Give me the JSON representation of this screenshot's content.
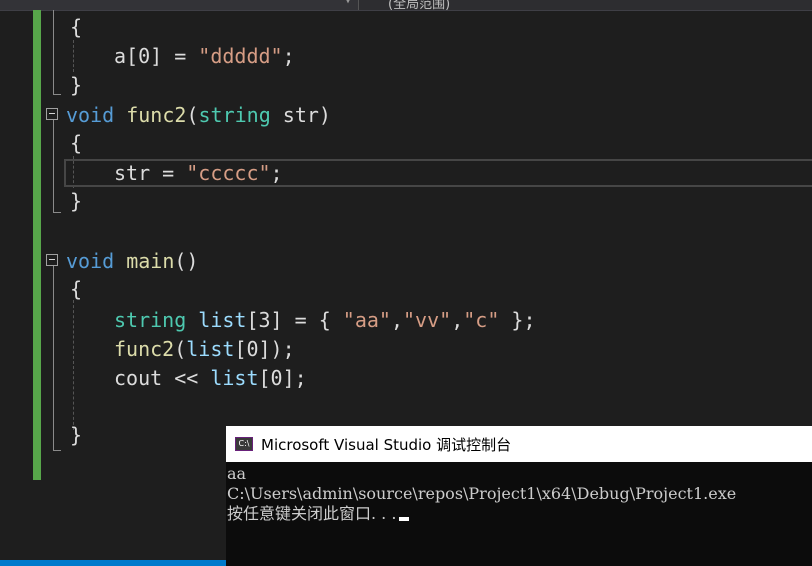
{
  "toolbar": {
    "scope_label": "(全局范围)"
  },
  "code": {
    "line_open1": "{",
    "line_assign_a": "a[0] = \"ddddd\";",
    "line_close1": "}",
    "func2": {
      "kw": "void",
      "name": "func2",
      "open_paren": "(",
      "param_type": "string",
      "param_name": "str",
      "close_paren": ")"
    },
    "line_open2": "{",
    "line_assign_str": "str = \"ccccc\";",
    "line_close2": "}",
    "main": {
      "kw": "void",
      "name": "main",
      "parens": "()"
    },
    "line_open3": "{",
    "decl": {
      "type": "string",
      "name": "list",
      "rest1": "[3] = { ",
      "s1": "\"aa\"",
      "comma1": ",",
      "s2": "\"vv\"",
      "comma2": ",",
      "s3": "\"c\"",
      "rest2": " };"
    },
    "call": {
      "fn": "func2",
      "open": "(",
      "arg": "list",
      "rest": "[0]);"
    },
    "cout": {
      "ident": "cout",
      "op": " << ",
      "arg": "list",
      "rest": "[0];"
    },
    "line_close3": "}"
  },
  "console": {
    "icon_text": "C:\\",
    "title": "Microsoft Visual Studio 调试控制台",
    "output": [
      "aa",
      "C:\\Users\\admin\\source\\repos\\Project1\\x64\\Debug\\Project1.exe",
      "按任意键关闭此窗口. . ."
    ]
  }
}
